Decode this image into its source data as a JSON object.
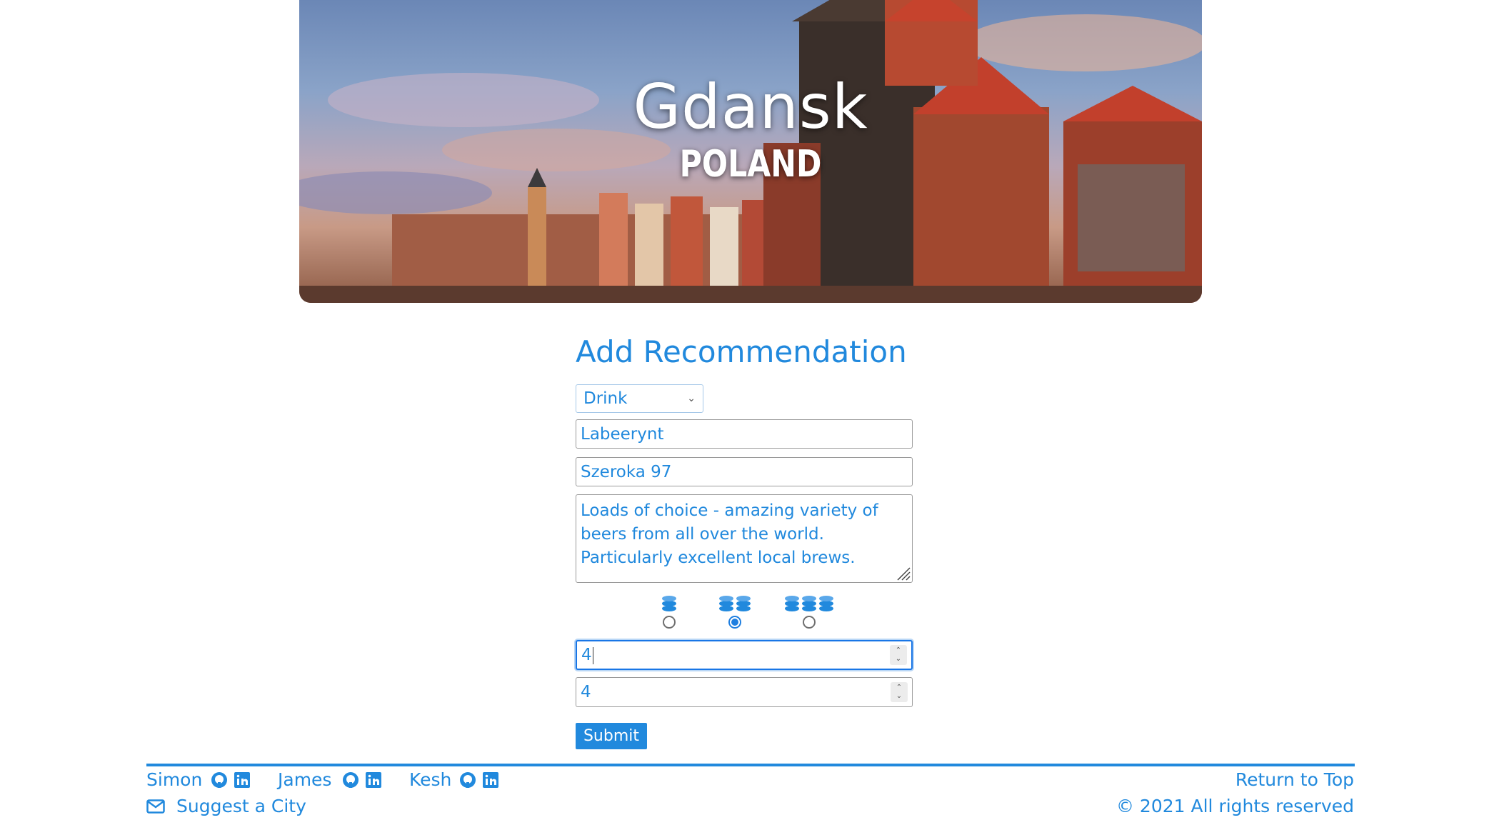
{
  "hero": {
    "city": "Gdansk",
    "country": "POLAND"
  },
  "form": {
    "title": "Add Recommendation",
    "category_selected": "Drink",
    "name_value": "Labeerynt",
    "address_value": "Szeroka 97",
    "description_value": "Loads of choice - amazing variety of beers from all over the world. Particularly excellent local brews.",
    "price_options": [
      {
        "icon": "coins-icon",
        "coins": 1,
        "checked": false
      },
      {
        "icon": "coins-icon",
        "coins": 2,
        "checked": true
      },
      {
        "icon": "coins-icon",
        "coins": 3,
        "checked": false
      }
    ],
    "rating_value_1": "4",
    "rating_value_2": "4",
    "submit_label": "Submit"
  },
  "footer": {
    "authors": [
      {
        "name": "Simon",
        "icons": [
          "github-icon",
          "linkedin-icon"
        ]
      },
      {
        "name": "James",
        "icons": [
          "github-icon",
          "linkedin-icon"
        ]
      },
      {
        "name": "Kesh",
        "icons": [
          "github-icon",
          "linkedin-icon"
        ]
      }
    ],
    "suggest_label": "Suggest a City",
    "return_top_label": "Return to Top",
    "copyright": "© 2021 All rights reserved"
  },
  "colors": {
    "accent": "#2189dd",
    "text_on_image": "#ffffff"
  }
}
